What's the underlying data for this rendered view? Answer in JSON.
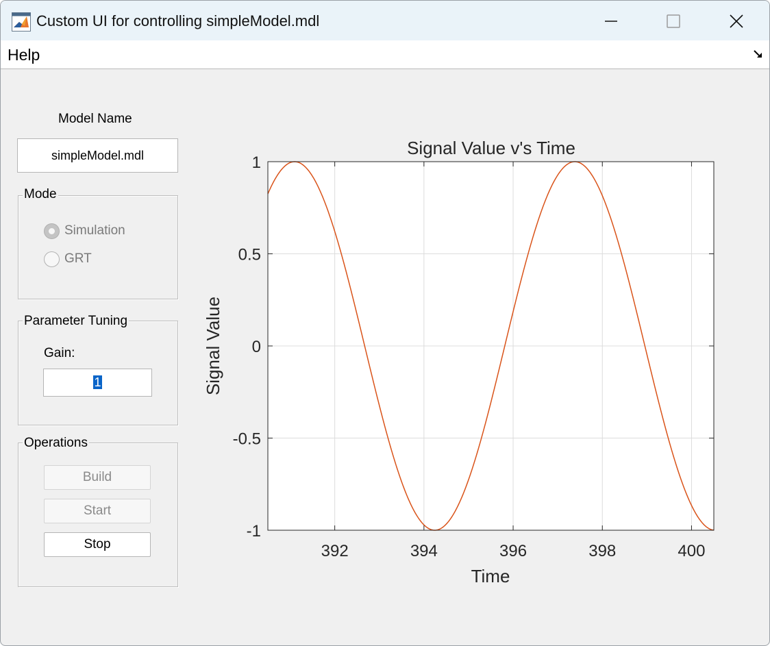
{
  "window": {
    "title": "Custom UI for controlling simpleModel.mdl",
    "controls": [
      "minimize-icon",
      "maximize-icon",
      "close-icon"
    ]
  },
  "menu": {
    "help_label": "Help",
    "toolbar_toggle_icon": "toolbar-toggle-arrow-icon"
  },
  "model": {
    "label": "Model Name",
    "value": "simpleModel.mdl"
  },
  "mode": {
    "title": "Mode",
    "options": [
      {
        "label": "Simulation",
        "selected": true
      },
      {
        "label": "GRT",
        "selected": false
      }
    ]
  },
  "tuning": {
    "title": "Parameter Tuning",
    "gain_label": "Gain:",
    "gain_value": "1"
  },
  "operations": {
    "title": "Operations",
    "build_label": "Build",
    "start_label": "Start",
    "stop_label": "Stop"
  },
  "chart_data": {
    "type": "line",
    "title": "Signal Value v's Time",
    "xlabel": "Time",
    "ylabel": "Signal Value",
    "xlim": [
      390.5,
      400.5
    ],
    "ylim": [
      -1,
      1
    ],
    "xticks": [
      392,
      394,
      396,
      398,
      400
    ],
    "yticks": [
      1,
      0.5,
      0,
      -0.5,
      -1
    ],
    "yticklabels": [
      "1",
      "0.5",
      "0",
      "-0.5",
      "-1"
    ],
    "grid": true,
    "series": [
      {
        "function": "sin",
        "amplitude": 1,
        "period": 6.283,
        "peak_at": 391.1,
        "x_range": [
          390.5,
          400.5
        ],
        "color": "#d95319"
      }
    ]
  }
}
